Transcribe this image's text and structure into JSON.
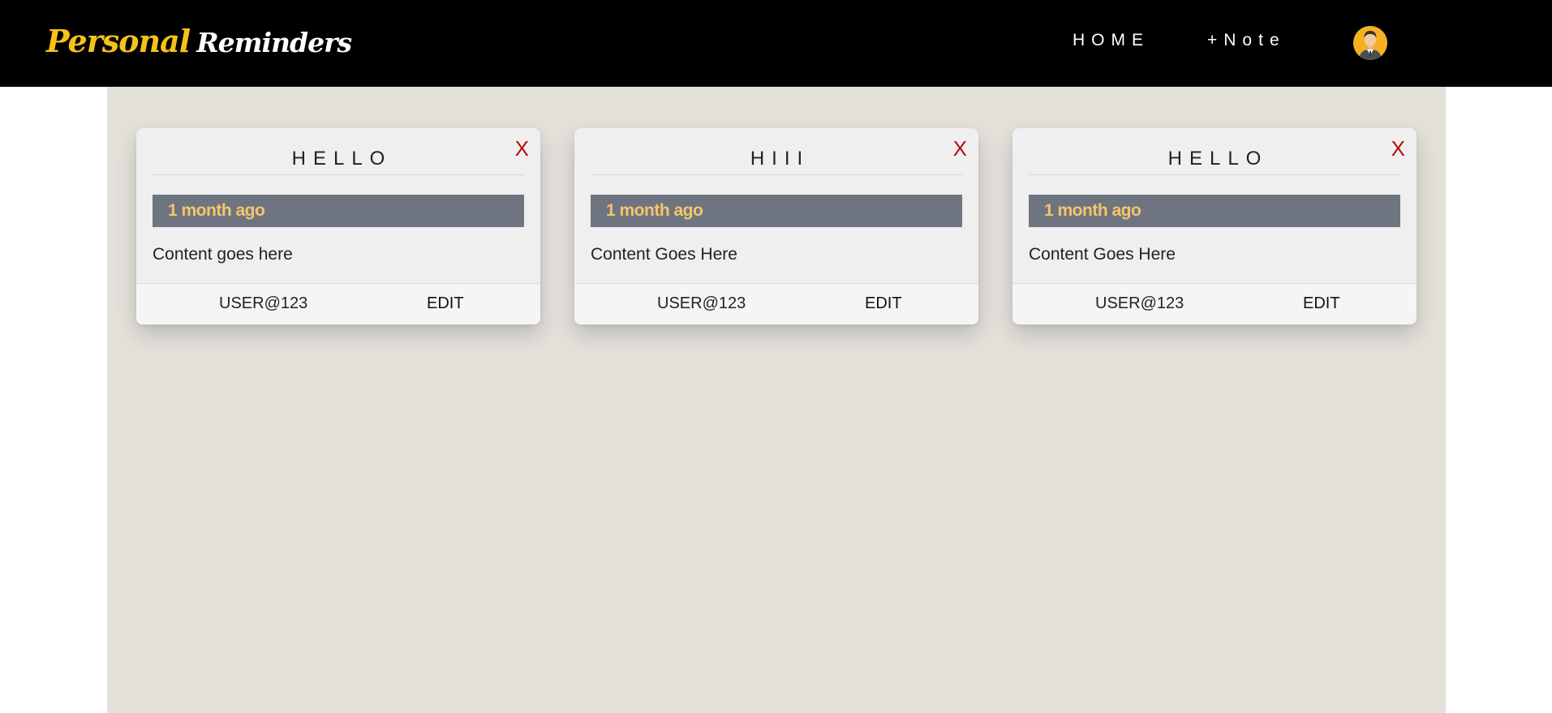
{
  "header": {
    "brand_part1": "Personal",
    "brand_part2": "Reminders",
    "nav": {
      "home_label": "HOME",
      "note_label": "+Note"
    },
    "avatar_icon": "user-avatar-icon"
  },
  "colors": {
    "navbar_bg": "#000000",
    "brand_accent": "#f6c218",
    "page_bg": "#e4e1db",
    "card_bg": "#efefef",
    "badge_bg": "#6e7580",
    "badge_text": "#f6c569",
    "close_red": "#b50d0d"
  },
  "notes": [
    {
      "title": "HELLO",
      "close_label": "X",
      "time": "1 month ago",
      "content": "Content goes here",
      "user": "USER@123",
      "edit_label": "EDIT"
    },
    {
      "title": "HIII",
      "close_label": "X",
      "time": "1 month ago",
      "content": "Content Goes Here",
      "user": "USER@123",
      "edit_label": "EDIT"
    },
    {
      "title": "HELLO",
      "close_label": "X",
      "time": "1 month ago",
      "content": "Content Goes Here",
      "user": "USER@123",
      "edit_label": "EDIT"
    }
  ]
}
